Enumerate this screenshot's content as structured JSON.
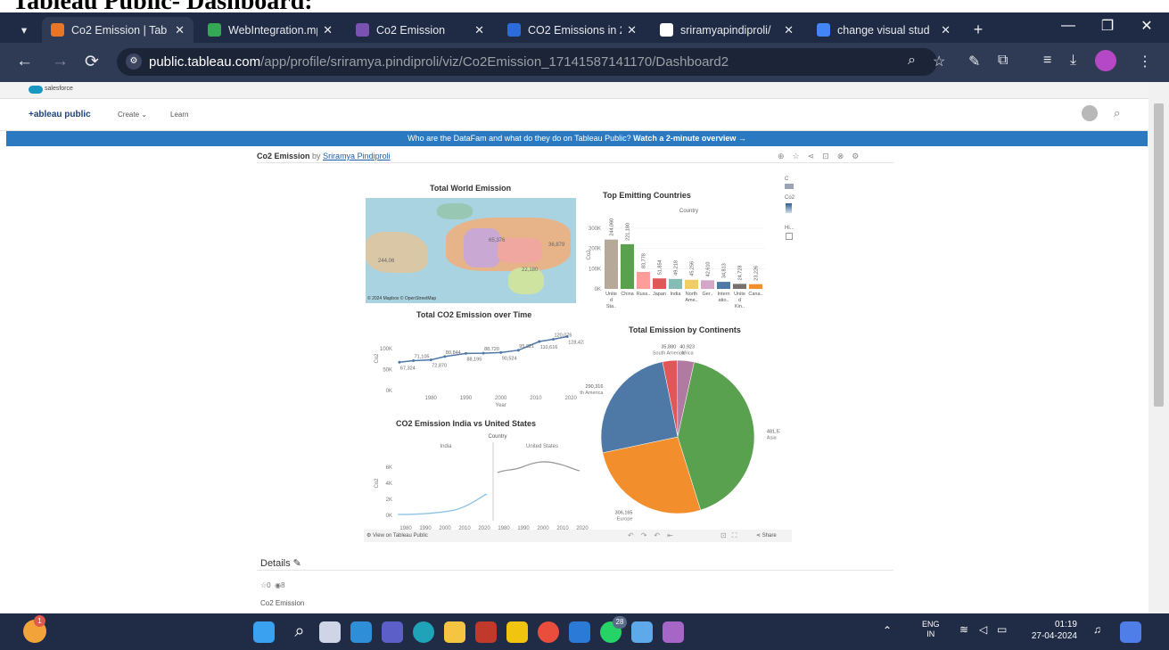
{
  "doc_title": "Tableau Public- Dashboard:",
  "browser": {
    "tabs": [
      {
        "label": "Co2 Emission | Tab",
        "icon": "tableau-icon",
        "icon_color": "#e97627",
        "active": true
      },
      {
        "label": "WebIntegration.mp",
        "icon": "drive-icon",
        "icon_color": "#34a853"
      },
      {
        "label": "Co2 Emission",
        "icon": "bootstrap-icon",
        "icon_color": "#7952b3"
      },
      {
        "label": "CO2 Emissions in 2",
        "icon": "iea-icon",
        "icon_color": "#2b6cd8"
      },
      {
        "label": "sriramyapindiproli/",
        "icon": "github-icon",
        "icon_color": "#ffffff"
      },
      {
        "label": "change visual stud",
        "icon": "google-icon",
        "icon_color": "#4285f4"
      }
    ],
    "url_domain": "public.tableau.com",
    "url_path": "/app/profile/sriramya.pindiproli/viz/Co2Emission_17141587141170/Dashboard2"
  },
  "site": {
    "salesforce": "salesforce",
    "logo": "+ableau public",
    "nav": [
      "Create",
      "Learn"
    ],
    "banner_text": "Who are the DataFam and what do they do on Tableau Public?",
    "banner_link": "Watch a 2-minute overview →"
  },
  "viz": {
    "title": "Co2 Emission",
    "by": "by",
    "author": "Sriramya Pindiproli",
    "view_on": "View on Tableau Public",
    "share": "Share",
    "details": "Details",
    "favorites": "0",
    "views": "8",
    "footer_name": "Co2 Emission",
    "map_credit": "© 2024 Mapbox © OpenStreetMap",
    "map_labels": [
      "36,879",
      "65,376",
      "22,180",
      "244,06"
    ]
  },
  "legend": {
    "c": "C",
    "co2": "Co2",
    "hi": "Hi..."
  },
  "charts": {
    "map_title": "Total World Emission",
    "bar_title": "Top Emitting Countries",
    "line_title": "Total CO2 Emission over Time",
    "pie_title": "Total Emission by Continents",
    "india_title": "CO2 Emission India vs United States",
    "country_hdr": "Country",
    "ylabel": "Co2",
    "xlabel": "Year"
  },
  "chart_data": [
    {
      "type": "bar",
      "title": "Top Emitting Countries",
      "xlabel": "Country",
      "ylabel": "Co2",
      "categories": [
        "Unite d Sta..",
        "China",
        "Russ..",
        "Japan",
        "India",
        "North Ame..",
        "Ger..",
        "Intern atio..",
        "Unite d Kin..",
        "Cana.."
      ],
      "values": [
        244060,
        221180,
        83778,
        51854,
        49218,
        45256,
        42610,
        34813,
        24728,
        23226
      ],
      "colors": [
        "#b7a99a",
        "#59a14f",
        "#ff9d9a",
        "#e15759",
        "#86bcb6",
        "#f1ce63",
        "#d4a6c8",
        "#4e79a7",
        "#79706e",
        "#f28e2b"
      ],
      "ylim": [
        0,
        300000
      ],
      "yticks": [
        "0K",
        "100K",
        "200K",
        "300K"
      ]
    },
    {
      "type": "line",
      "title": "Total CO2 Emission over Time",
      "xlabel": "Year",
      "ylabel": "Co2",
      "x": [
        1971,
        1975,
        1980,
        1984,
        1990,
        1995,
        2000,
        2005,
        2011,
        2015,
        2019
      ],
      "y": [
        67324,
        71105,
        72870,
        80844,
        88195,
        88720,
        90524,
        95821,
        116616,
        122076,
        128423
      ],
      "labels": [
        "67,324",
        "71,105",
        "72,870",
        "80,844",
        "88,195",
        "88,720",
        "90,524",
        "95,821",
        "110,616",
        "120,076",
        "128,423"
      ],
      "extra_labels": [
        "74,498",
        "89,954",
        "90,998"
      ],
      "xticks": [
        "1980",
        "1990",
        "2000",
        "2010",
        "2020"
      ],
      "yticks": [
        "0K",
        "50K",
        "100K"
      ],
      "ylim": [
        0,
        140000
      ]
    },
    {
      "type": "pie",
      "title": "Total Emission by Continents",
      "slices": [
        {
          "name": "Asia",
          "label": "481,573",
          "value": 481573,
          "color": "#59a14f"
        },
        {
          "name": "Europe",
          "label": "306,165",
          "value": 306165,
          "color": "#f28e2b"
        },
        {
          "name": "North America",
          "label": "290,316",
          "value": 290316,
          "color": "#4e79a7"
        },
        {
          "name": "South America",
          "label": "35,880",
          "value": 35880,
          "color": "#e15759"
        },
        {
          "name": "Africa",
          "label": "40,923",
          "value": 40923,
          "color": "#b07aa1"
        }
      ]
    },
    {
      "type": "line",
      "title": "CO2 Emission India vs United States",
      "xlabel": "Year",
      "ylabel": "Co2",
      "series": [
        {
          "name": "India"
        },
        {
          "name": "United States"
        }
      ],
      "xticks": [
        "1980",
        "1990",
        "2000",
        "2010",
        "2020"
      ],
      "yticks": [
        "0K",
        "2K",
        "4K",
        "6K"
      ]
    }
  ],
  "taskbar": {
    "time": "01:19",
    "date": "27-04-2024",
    "lang": "ENG",
    "region": "IN",
    "badge_teams": "28",
    "badge_notify": "1"
  }
}
